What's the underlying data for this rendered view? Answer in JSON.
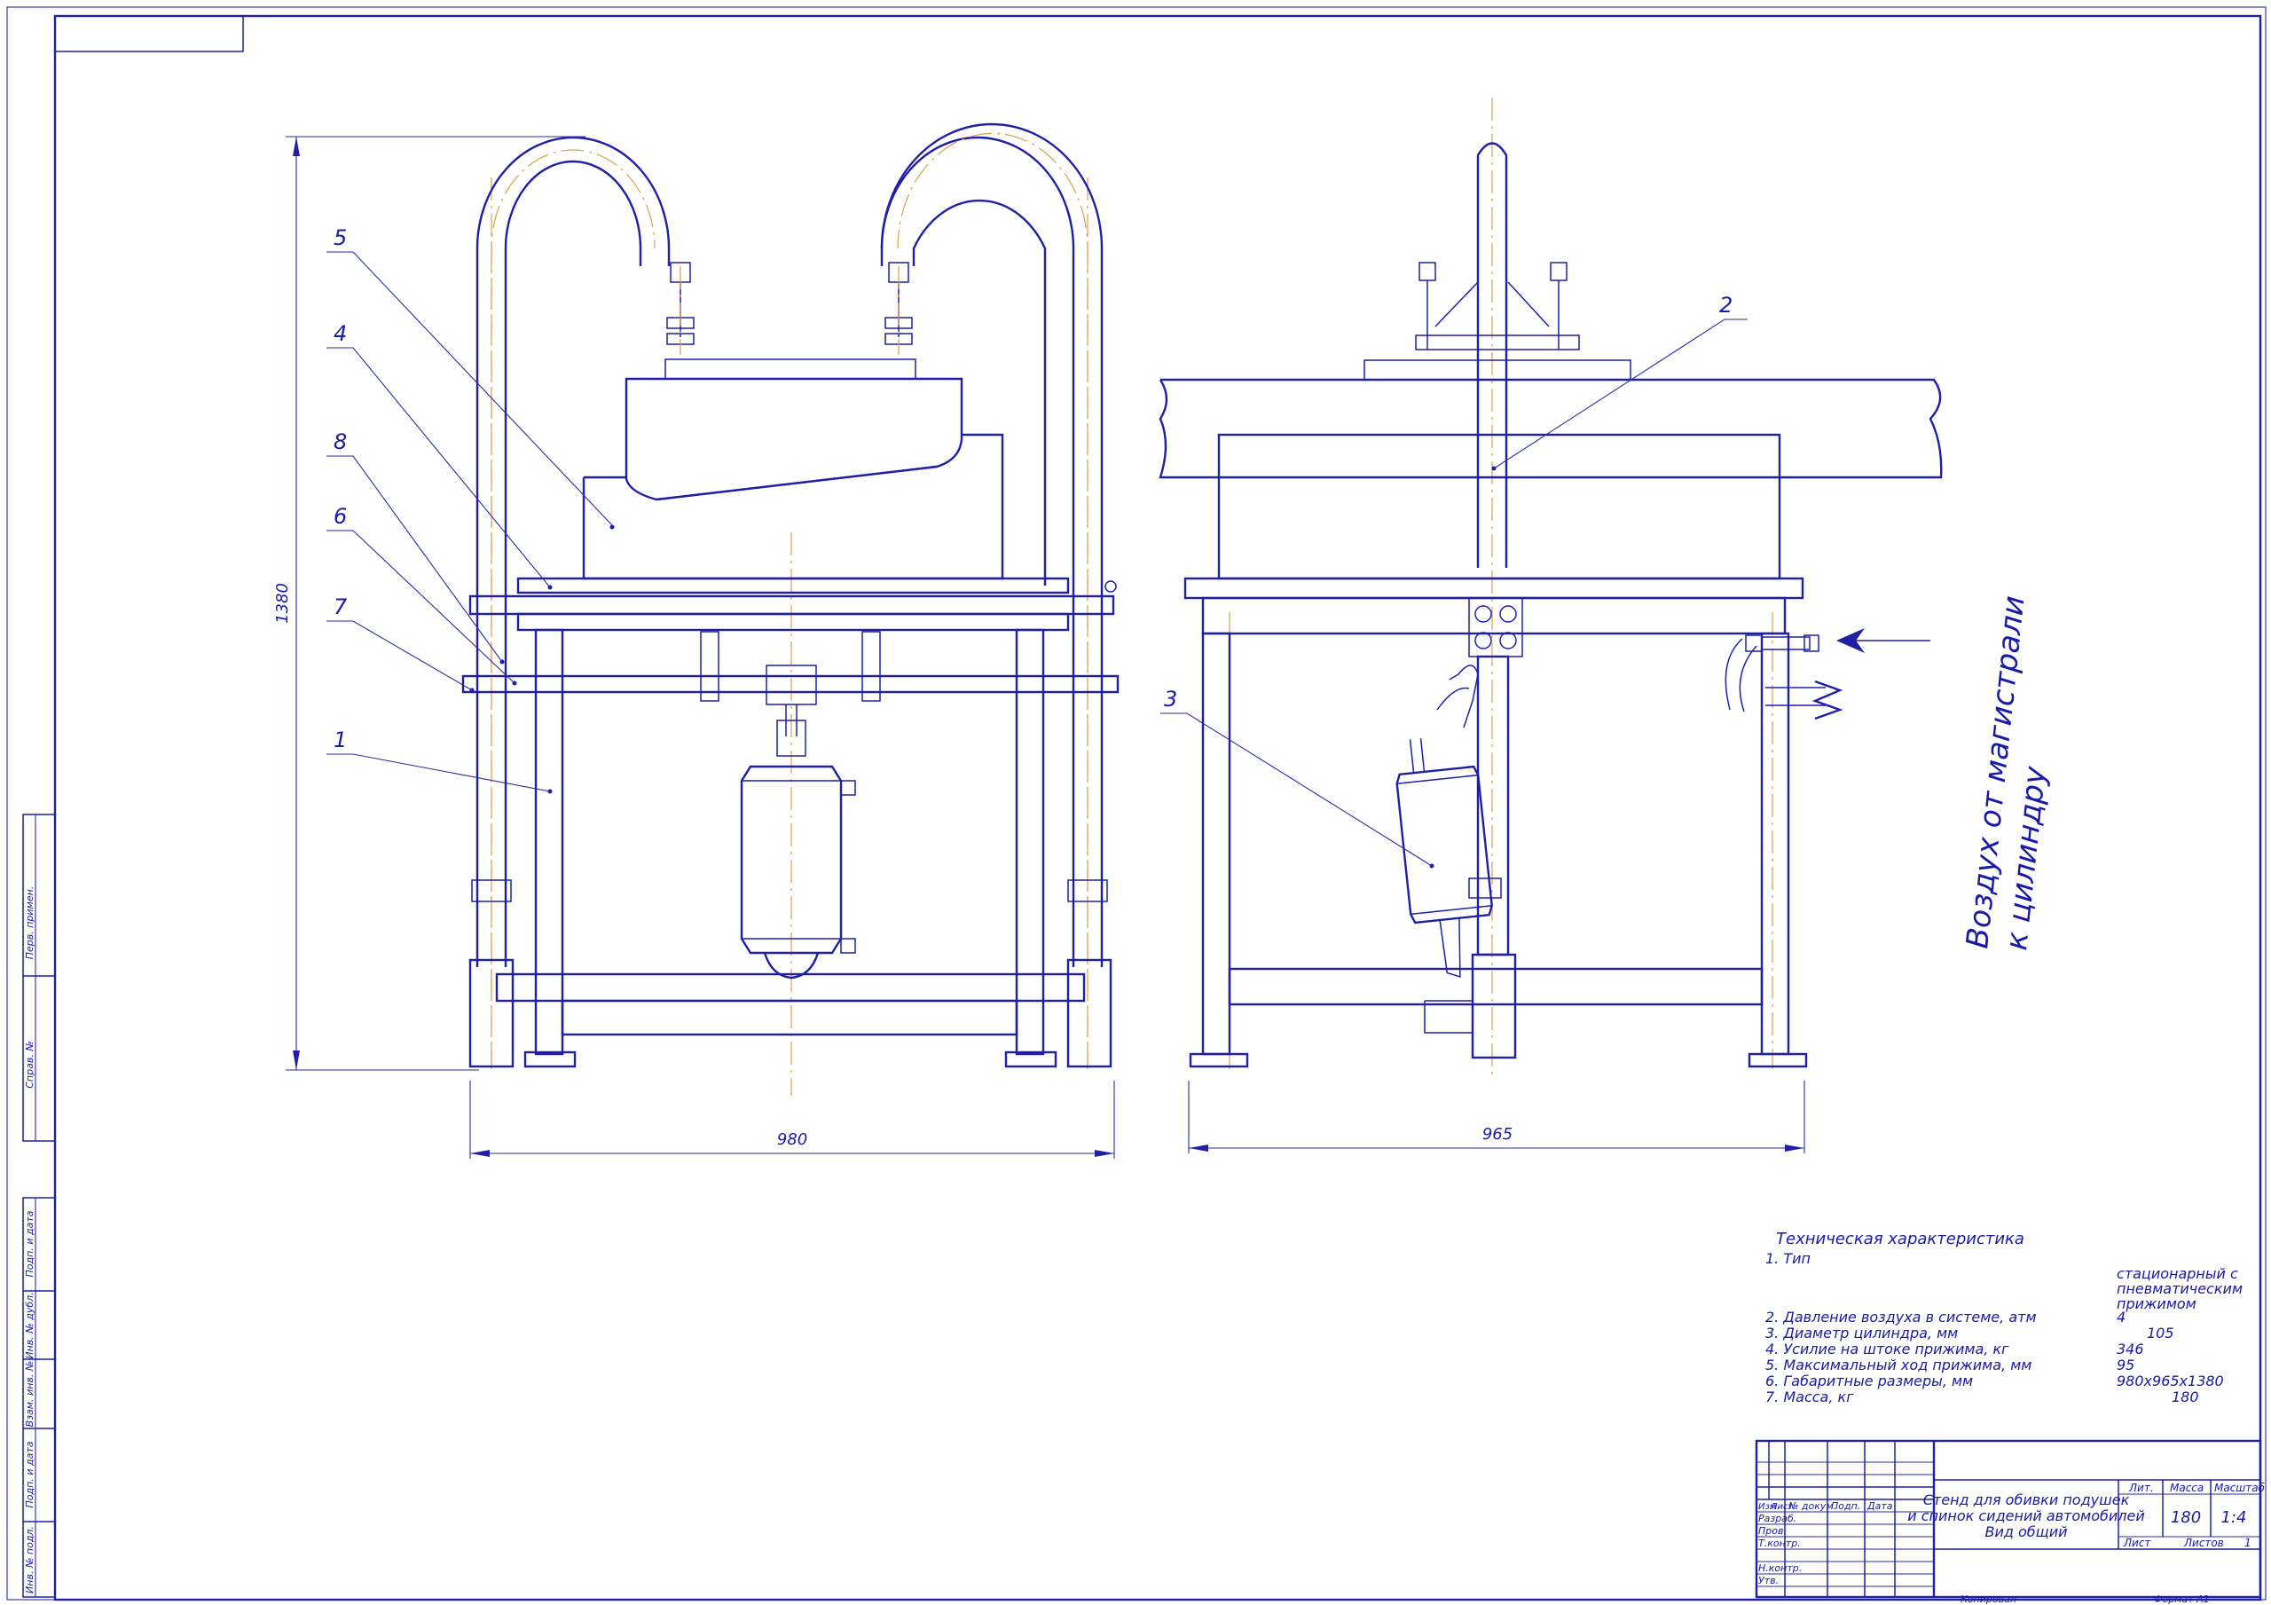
{
  "callouts": [
    "1",
    "2",
    "3",
    "4",
    "5",
    "6",
    "7",
    "8"
  ],
  "dimensions": {
    "height_front": "1380",
    "width_front": "980",
    "width_side": "965"
  },
  "air_note": {
    "line1": "Воздух от магистрали",
    "line2": "к цилиндру"
  },
  "tech": {
    "heading": "Техническая характеристика",
    "rows": [
      {
        "label": "1. Тип",
        "value": ""
      },
      {
        "label": "",
        "value": "стационарный с"
      },
      {
        "label": "",
        "value": "пневматическим"
      },
      {
        "label": "",
        "value": "прижимом"
      },
      {
        "label": "2. Давление воздуха в системе, атм",
        "value": "4"
      },
      {
        "label": "3. Диаметр цилиндра, мм",
        "value": "105"
      },
      {
        "label": "4. Усилие на штоке прижима, кг",
        "value": "346"
      },
      {
        "label": "5. Максимальный ход прижима, мм",
        "value": "95"
      },
      {
        "label": "6. Габаритные размеры, мм",
        "value": "980x965x1380"
      },
      {
        "label": "7. Масса, кг",
        "value": "180"
      }
    ]
  },
  "title_block": {
    "title_line1": "Стенд для обивки подушек",
    "title_line2": "и спинок сидений автомобилей",
    "title_line3": "Вид общий",
    "head_izm": "Изм",
    "head_list": "Лист",
    "head_doc": "№ докум.",
    "head_podp": "Подп.",
    "head_data": "Дата",
    "razrab": "Разраб.",
    "prov": "Пров.",
    "tkontr": "Т.контр.",
    "nkontr": "Н.контр.",
    "utv": "Утв.",
    "lit_label": "Лит.",
    "mass_label": "Масса",
    "scale_label": "Масштаб",
    "mass_value": "180",
    "scale_value": "1:4",
    "sheet_label": "Лист",
    "sheets_label": "Листов",
    "sheets_value": "1",
    "copied": "Копировал",
    "format": "Формат   А1"
  },
  "side_stamp": {
    "perv": "Перв. примен.",
    "sprav": "Справ. №",
    "podp1": "Подп. и дата",
    "inv_dubl": "Инв. № дубл.",
    "vzam": "Взам. инв. №",
    "podp2": "Подп. и дата",
    "inv_podl": "Инв. № подл."
  }
}
